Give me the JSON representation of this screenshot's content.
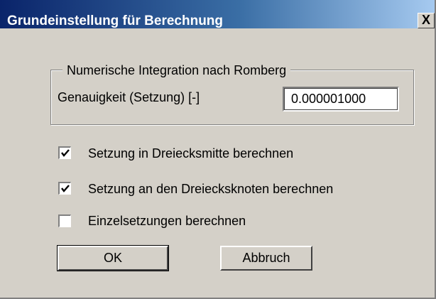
{
  "window": {
    "title": "Grundeinstellung für Berechnung",
    "close_label": "X"
  },
  "group": {
    "legend": "Numerische Integration nach Romberg",
    "accuracy_label": "Genauigkeit (Setzung) [-]",
    "accuracy_value": "0.000001000"
  },
  "options": [
    {
      "label": "Setzung in Dreiecksmitte berechnen",
      "checked": true
    },
    {
      "label": "Setzung an den Dreiecksknoten berechnen",
      "checked": true
    },
    {
      "label": "Einzelsetzungen berechnen",
      "checked": false
    }
  ],
  "buttons": {
    "ok_label": "OK",
    "cancel_label": "Abbruch"
  }
}
